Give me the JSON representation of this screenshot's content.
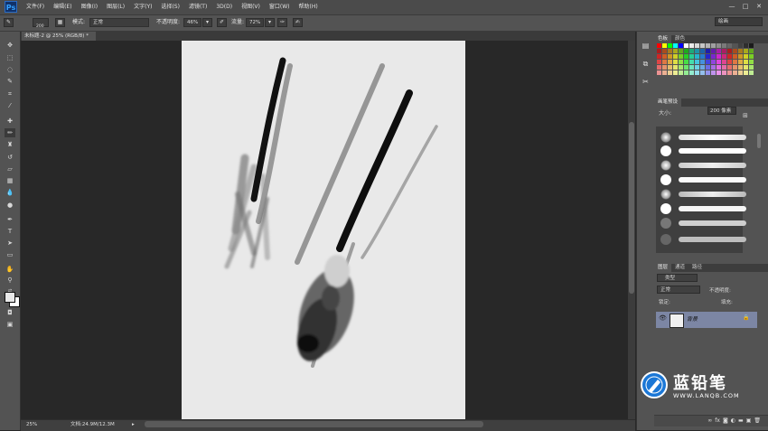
{
  "app": {
    "logo": "Ps",
    "window_controls": [
      "—",
      "□",
      "✕"
    ]
  },
  "menubar": {
    "items": [
      "文件(F)",
      "编辑(E)",
      "图像(I)",
      "图层(L)",
      "文字(Y)",
      "选择(S)",
      "滤镜(T)",
      "3D(D)",
      "视图(V)",
      "窗口(W)",
      "帮助(H)"
    ]
  },
  "options": {
    "brush_size": "200",
    "mode_label": "模式:",
    "mode_value": "正常",
    "opacity_label": "不透明度:",
    "opacity_value": "46%",
    "flow_label": "流量:",
    "flow_value": "72%",
    "workspace": "绘画"
  },
  "document": {
    "tab_title": "未标题-2 @ 25% (RGB/8) *",
    "close": "×"
  },
  "status": {
    "zoom": "25%",
    "doc_info": "文档:24.9M/12.3M"
  },
  "panels": {
    "swatches_tabs": [
      "色板",
      "颜色"
    ],
    "brush_preset_tab": "画笔预设",
    "brush_size_label": "大小:",
    "brush_size_value": "200 像素",
    "layers_tabs": [
      "图层",
      "通道",
      "路径"
    ],
    "layer_kind": "类型",
    "blend_mode": "正常",
    "opacity_label": "不透明度:",
    "lock_label": "锁定:",
    "fill_label": "填充:",
    "layer_name": "背景"
  },
  "watermark": {
    "title": "蓝铅笔",
    "url": "WWW.LANQB.COM"
  },
  "colors": {
    "accent": "#1b77d6",
    "layer_selected": "#7c86a4",
    "panel_bg": "#535353",
    "canvas_bg": "#e9e9e9"
  }
}
